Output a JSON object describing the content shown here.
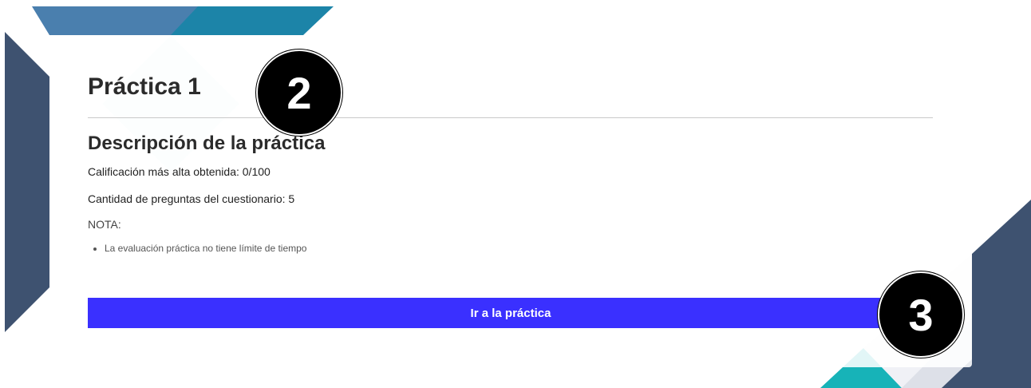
{
  "practice": {
    "title": "Práctica 1",
    "description_heading": "Descripción de la práctica",
    "highest_score": "Calificación más alta obtenida: 0/100",
    "question_count": "Cantidad de preguntas del cuestionario: 5",
    "note_label": "NOTA:",
    "notes": [
      "La evaluación práctica no tiene límite de tiempo"
    ],
    "go_button_label": "Ir a la práctica"
  },
  "annotations": {
    "marker_2": "2",
    "marker_3": "3"
  },
  "colors": {
    "button": "#3a30ff",
    "navy": "#3e5270",
    "teal": "#1c84a8",
    "steel_blue": "#4a7fae",
    "cyan": "#17b3b8"
  }
}
